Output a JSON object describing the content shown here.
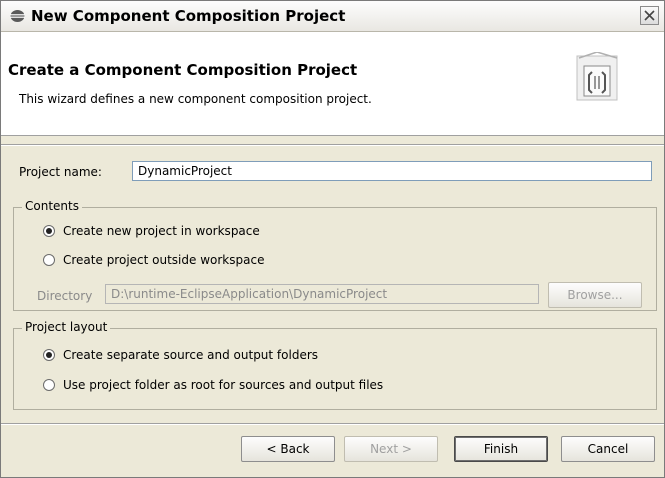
{
  "window": {
    "title": "New Component Composition Project"
  },
  "banner": {
    "heading": "Create a Component Composition Project",
    "description": "This wizard defines a new component composition project."
  },
  "project_name": {
    "label": "Project name:",
    "value": "DynamicProject"
  },
  "contents": {
    "legend": "Contents",
    "option_in_workspace": "Create new project in workspace",
    "option_outside_workspace": "Create project outside workspace",
    "selected": "Create new project in workspace",
    "directory_label": "Directory",
    "directory_value": "D:\\runtime-EclipseApplication\\DynamicProject",
    "browse_label": "Browse..."
  },
  "layout": {
    "legend": "Project layout",
    "option_separate": "Create separate source and output folders",
    "option_root": "Use project folder as root for sources and output files",
    "selected": "Create separate source and output folders"
  },
  "buttons": {
    "back": "< Back",
    "next": "Next >",
    "finish": "Finish",
    "cancel": "Cancel"
  }
}
